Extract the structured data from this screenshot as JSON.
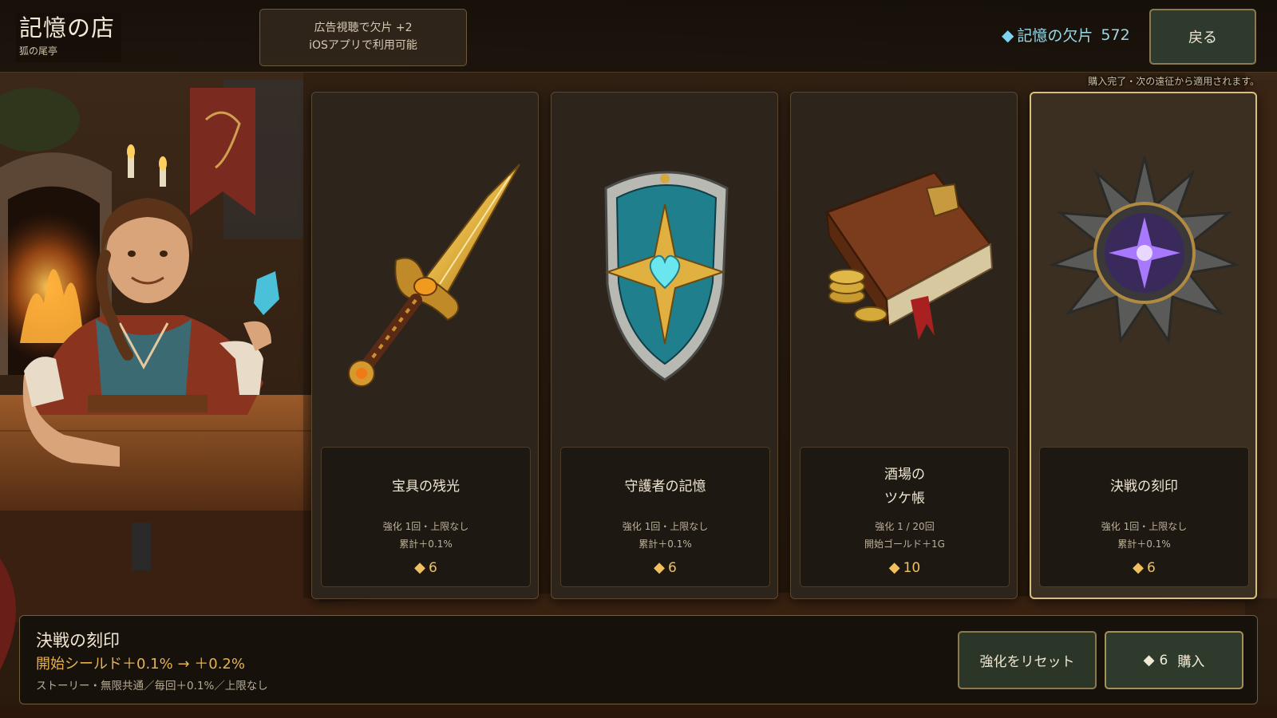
{
  "header": {
    "title": "記憶の店",
    "subtitle": "狐の尾亭",
    "ad_line1": "広告視聴で欠片 +2",
    "ad_line2": "iOSアプリで利用可能",
    "currency_label": "記憶の欠片",
    "currency_value": "572",
    "currency_icon": "diamond-icon",
    "back_label": "戻る"
  },
  "notice": "購入完了・次の遠征から適用されます。",
  "items": [
    {
      "name": "宝具の残光",
      "desc1": "強化 1回・上限なし",
      "desc2": "累計＋0.1%",
      "price": "6",
      "icon": "golden-dagger-icon",
      "selected": false
    },
    {
      "name": "守護者の記憶",
      "desc1": "強化 1回・上限なし",
      "desc2": "累計＋0.1%",
      "price": "6",
      "icon": "heart-shield-icon",
      "selected": false
    },
    {
      "name": "酒場の\nツケ帳",
      "desc1": "強化 1 / 20回",
      "desc2": "開始ゴールド＋1G",
      "price": "10",
      "icon": "ledger-book-icon",
      "selected": false
    },
    {
      "name": "決戦の刻印",
      "desc1": "強化 1回・上限なし",
      "desc2": "累計＋0.1%",
      "price": "6",
      "icon": "spiked-sigil-icon",
      "selected": true
    }
  ],
  "detail": {
    "name": "決戦の刻印",
    "effect": "開始シールド＋0.1% → ＋0.2%",
    "note": "ストーリー・無限共通／毎回＋0.1%／上限なし",
    "reset_label": "強化をリセット",
    "buy_price": "6",
    "buy_label": "購入"
  },
  "colors": {
    "accent_gold": "#e6b24e",
    "currency_cyan": "#9ad8e8",
    "panel_bg": "#2d251b",
    "selected_border": "#d6c07c"
  }
}
